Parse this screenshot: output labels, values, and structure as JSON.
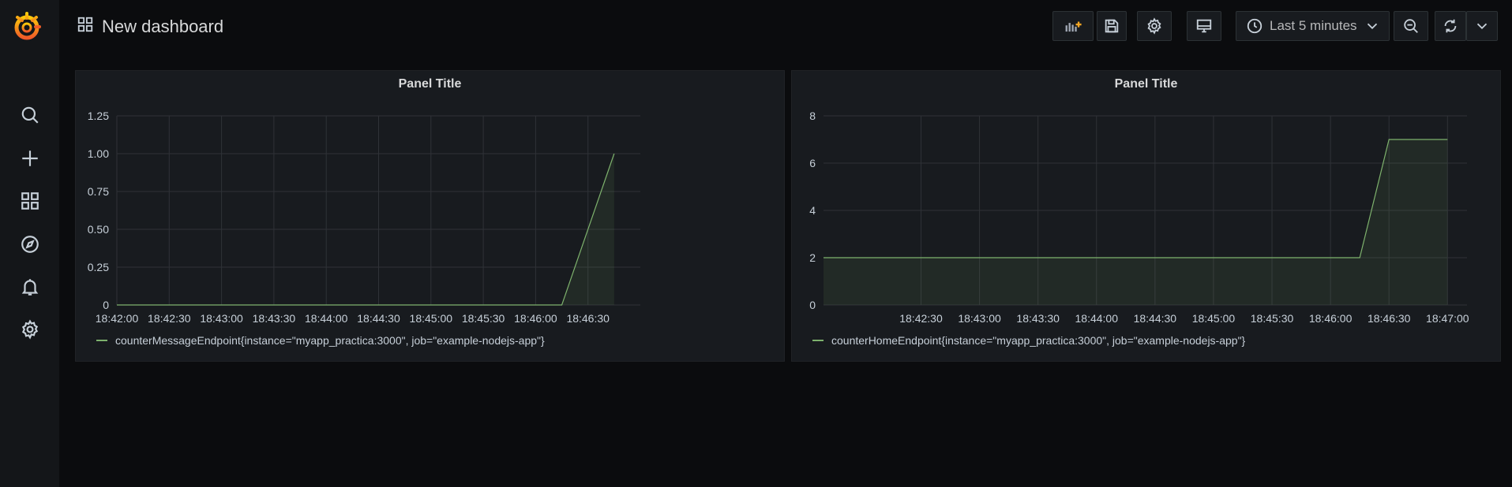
{
  "dashboard": {
    "title": "New dashboard"
  },
  "time_picker": {
    "label": "Last 5 minutes"
  },
  "sidebar": {
    "items": [
      {
        "icon": "search-icon"
      },
      {
        "icon": "plus-icon"
      },
      {
        "icon": "dashboards-icon"
      },
      {
        "icon": "explore-icon"
      },
      {
        "icon": "bell-icon"
      },
      {
        "icon": "gear-icon"
      }
    ]
  },
  "colors": {
    "series": "#7eb26d",
    "accent": "#f15a24"
  },
  "panels": [
    {
      "title": "Panel Title",
      "legend": "counterMessageEndpoint{instance=\"myapp_practica:3000\", job=\"example-nodejs-app\"}"
    },
    {
      "title": "Panel Title",
      "legend": "counterHomeEndpoint{instance=\"myapp_practica:3000\", job=\"example-nodejs-app\"}"
    }
  ],
  "chart_data": [
    {
      "type": "line",
      "title": "Panel Title",
      "x_range": [
        "18:42:00",
        "18:47:00"
      ],
      "x_ticks": [
        "18:42:00",
        "18:42:30",
        "18:43:00",
        "18:43:30",
        "18:44:00",
        "18:44:30",
        "18:45:00",
        "18:45:30",
        "18:46:00",
        "18:46:30"
      ],
      "y_ticks": [
        "0",
        "0.25",
        "0.50",
        "0.75",
        "1.00",
        "1.25"
      ],
      "ylim": [
        0,
        1.25
      ],
      "grid": true,
      "legend_position": "bottom-left",
      "series": [
        {
          "name": "counterMessageEndpoint{instance=\"myapp_practica:3000\", job=\"example-nodejs-app\"}",
          "points": [
            [
              "18:42:00",
              0
            ],
            [
              "18:46:15",
              0
            ],
            [
              "18:46:45",
              1
            ]
          ]
        }
      ]
    },
    {
      "type": "line",
      "title": "Panel Title",
      "x_range": [
        "18:41:40",
        "18:47:10"
      ],
      "x_ticks": [
        "18:42:30",
        "18:43:00",
        "18:43:30",
        "18:44:00",
        "18:44:30",
        "18:45:00",
        "18:45:30",
        "18:46:00",
        "18:46:30",
        "18:47:00"
      ],
      "y_ticks": [
        "0",
        "2",
        "4",
        "6",
        "8"
      ],
      "ylim": [
        0,
        8
      ],
      "grid": true,
      "legend_position": "bottom-left",
      "series": [
        {
          "name": "counterHomeEndpoint{instance=\"myapp_practica:3000\", job=\"example-nodejs-app\"}",
          "points": [
            [
              "18:41:40",
              2
            ],
            [
              "18:46:15",
              2
            ],
            [
              "18:46:30",
              7
            ],
            [
              "18:47:00",
              7
            ]
          ]
        }
      ]
    }
  ]
}
